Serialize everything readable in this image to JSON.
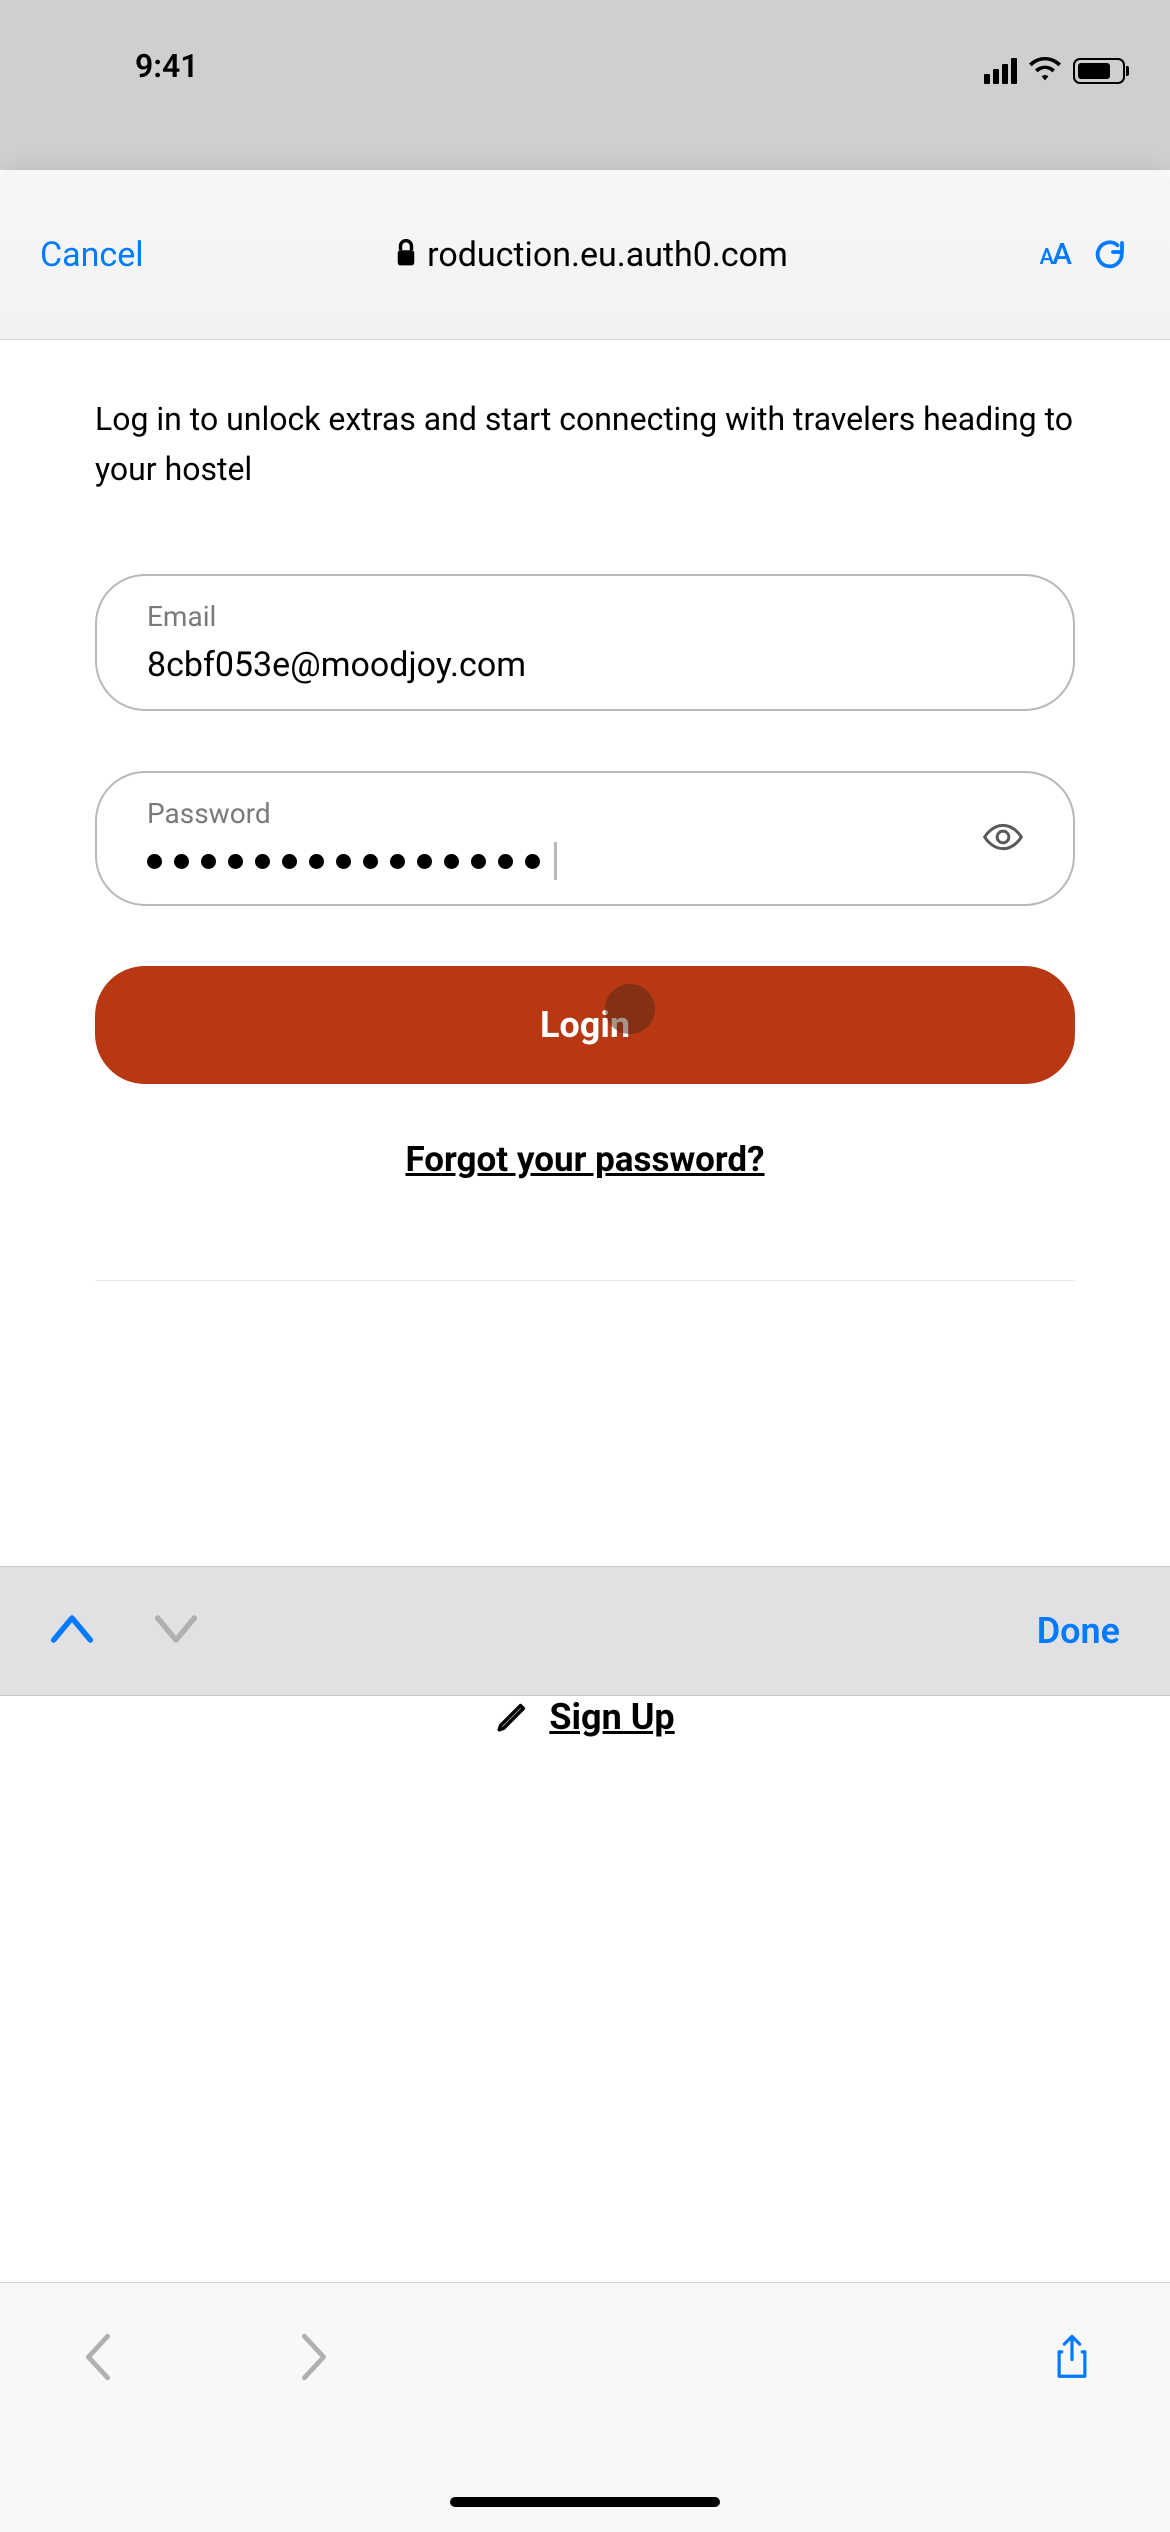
{
  "status_bar": {
    "time": "9:41"
  },
  "browser": {
    "cancel_label": "Cancel",
    "url_display": "roduction.eu.auth0.com",
    "reader_label_small": "A",
    "reader_label_large": "A"
  },
  "login_form": {
    "intro": "Log in to unlock extras and start connecting with travelers heading to your hostel",
    "email_label": "Email",
    "email_value": "8cbf053e@moodjoy.com",
    "password_label": "Password",
    "password_dot_count": 15,
    "login_button": "Login",
    "forgot_link": "Forgot your password?",
    "signup_link": "Sign Up"
  },
  "keyboard_accessory": {
    "done_label": "Done"
  },
  "colors": {
    "accent_blue": "#007aff",
    "login_red": "#b83814"
  }
}
